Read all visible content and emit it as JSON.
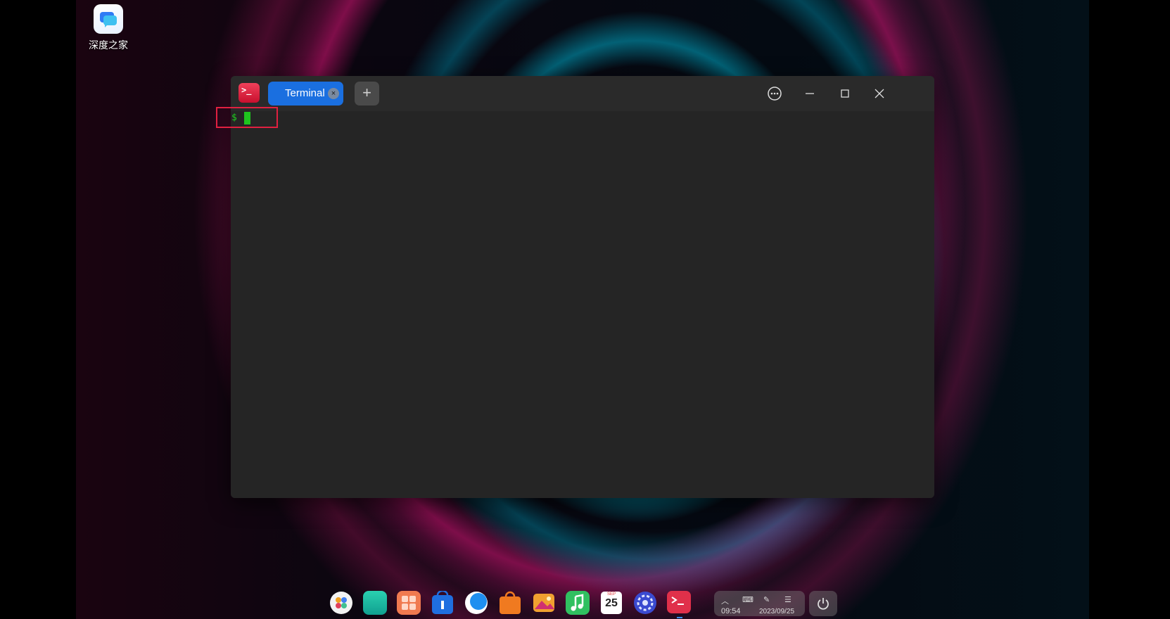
{
  "desktop": {
    "icons": [
      {
        "label": "深度之家",
        "icon": "deepin-home-icon"
      }
    ]
  },
  "window": {
    "app_icon_text": ">_",
    "tab": {
      "label": "Terminal",
      "close_glyph": "×"
    },
    "new_tab_label": "+",
    "buttons": {
      "menu": "more-options-icon",
      "minimize": "minimize-icon",
      "maximize": "maximize-icon",
      "close": "close-icon"
    }
  },
  "terminal": {
    "prompt": "$"
  },
  "dock": {
    "items": [
      "launcher-icon",
      "file-manager-icon",
      "app-grid-icon",
      "app-store-icon",
      "browser-icon",
      "store-bag-icon",
      "photos-icon",
      "music-icon",
      "calendar-icon",
      "settings-icon",
      "terminal-icon"
    ],
    "calendar_month": "SEP",
    "calendar_day": "25"
  },
  "tray": {
    "time": "09:54",
    "date": "2023/09/25"
  }
}
